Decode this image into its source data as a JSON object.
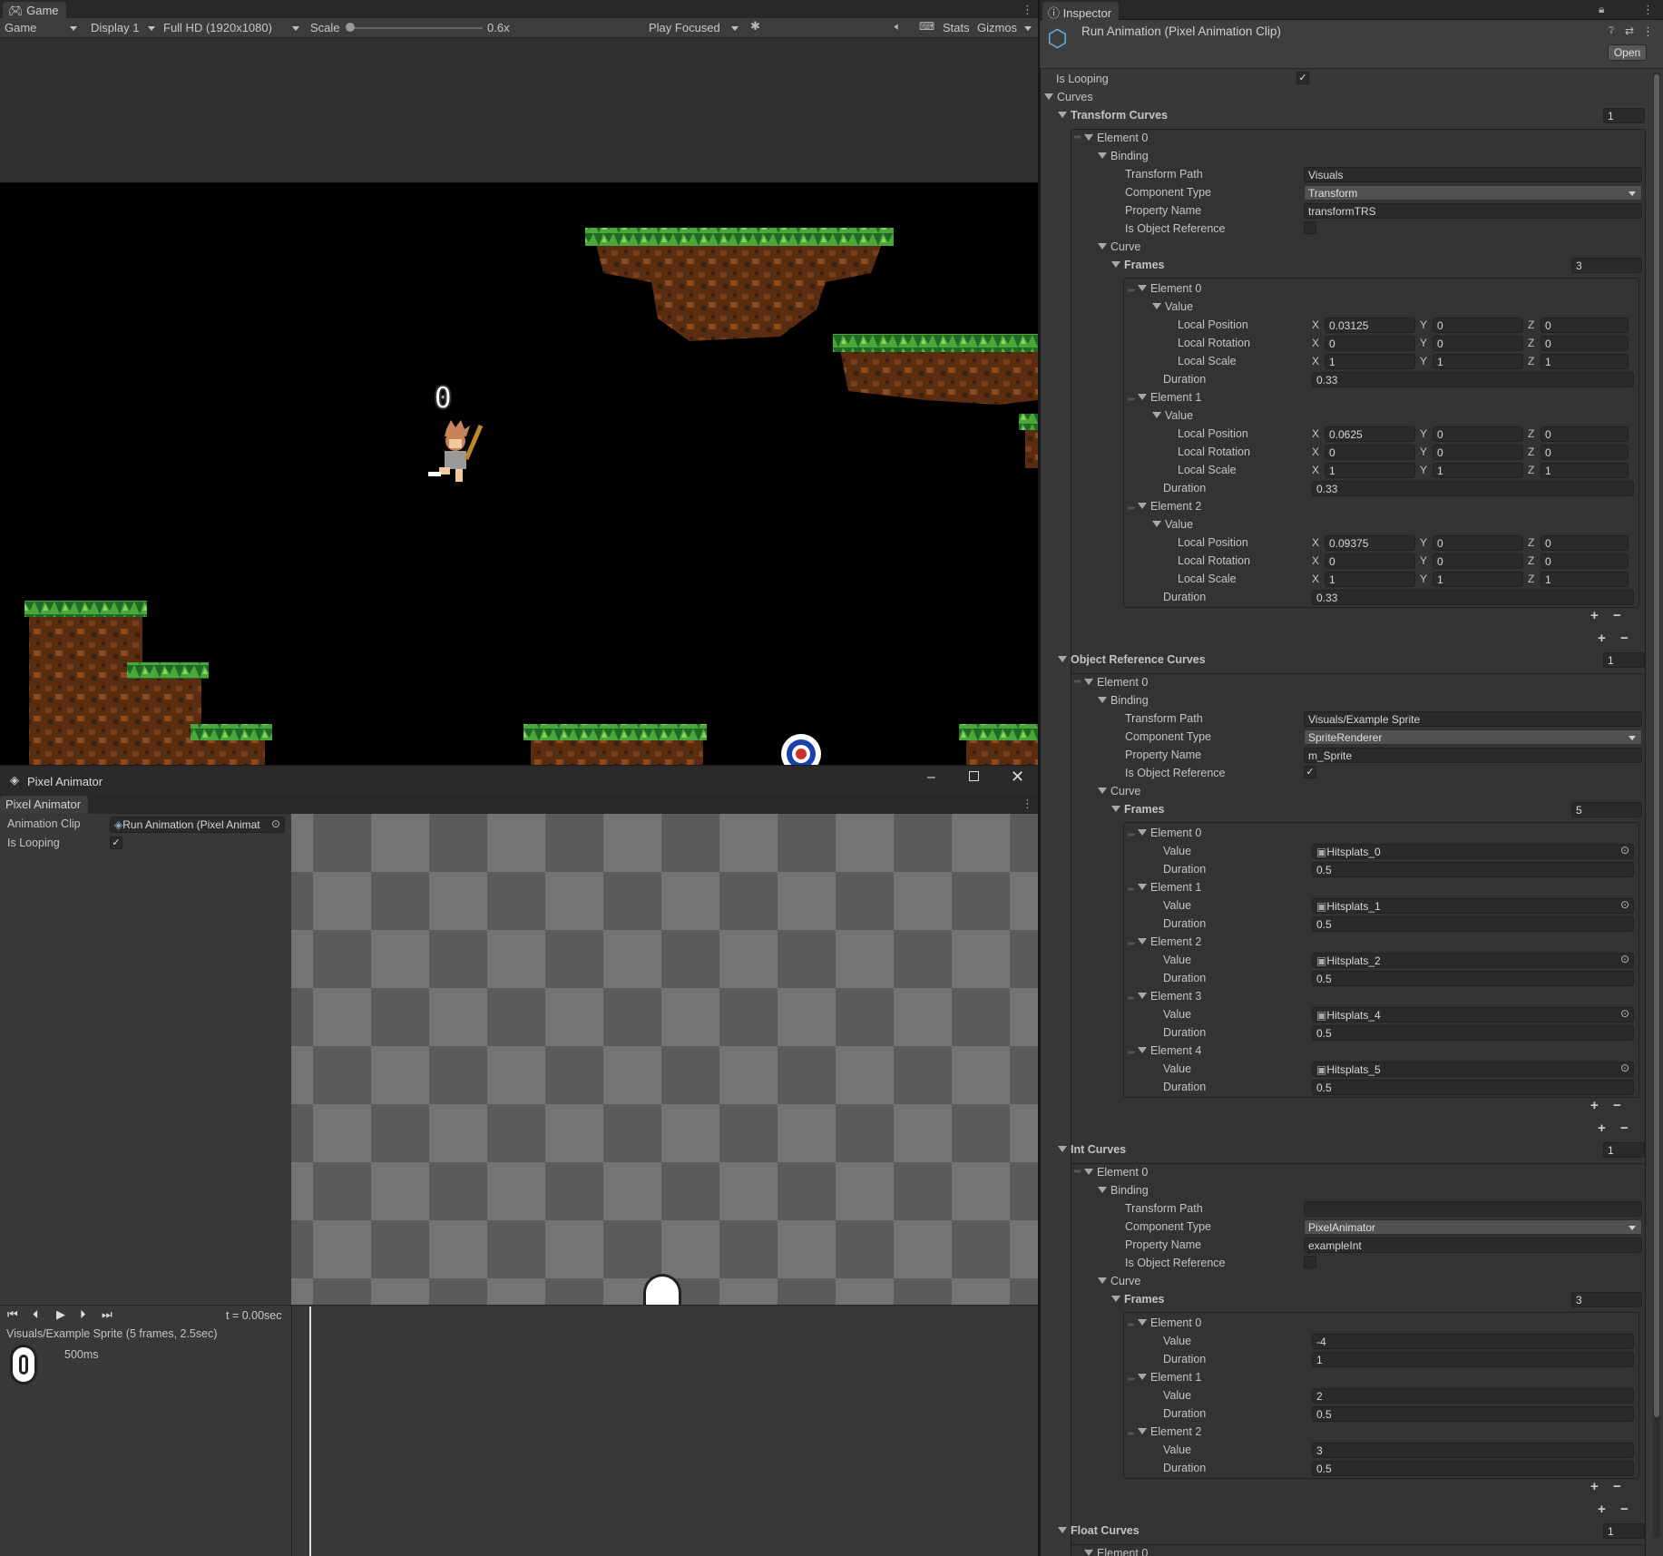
{
  "game": {
    "tab": "Game",
    "mode": "Game",
    "display": "Display 1",
    "resolution": "Full HD (1920x1080)",
    "scale_label": "Scale",
    "scale_value": "0.6x",
    "play_focused": "Play Focused",
    "stats": "Stats",
    "gizmos": "Gizmos",
    "score": "0"
  },
  "animator": {
    "title": "Pixel Animator",
    "tab": "Pixel Animator",
    "clip_label": "Animation Clip",
    "clip_value": "Run Animation (Pixel Animat",
    "loop_label": "Is Looping",
    "time": "t = 0.00sec",
    "track": "Visuals/Example Sprite (5 frames, 2.5sec)",
    "frame_ms": "500ms"
  },
  "inspector": {
    "tab": "Inspector",
    "asset_title": "Run Animation (Pixel Animation Clip)",
    "open": "Open",
    "is_looping": "Is Looping",
    "curves": "Curves",
    "tc": {
      "title": "Transform Curves",
      "count": "1",
      "el": "Element 0",
      "binding": "Binding",
      "tp": "Transform Path",
      "tp_v": "Visuals",
      "ct": "Component Type",
      "ct_v": "Transform",
      "pn": "Property Name",
      "pn_v": "transformTRS",
      "ior": "Is Object Reference",
      "curve": "Curve",
      "frames": "Frames",
      "frames_n": "3",
      "f": [
        {
          "el": "Element 0",
          "value": "Value",
          "lp": "Local Position",
          "lr": "Local Rotation",
          "ls": "Local Scale",
          "dur": "Duration",
          "px": "0.03125",
          "py": "0",
          "pz": "0",
          "rx": "0",
          "ry": "0",
          "rz": "0",
          "sx": "1",
          "sy": "1",
          "sz": "1",
          "d": "0.33"
        },
        {
          "el": "Element 1",
          "value": "Value",
          "lp": "Local Position",
          "lr": "Local Rotation",
          "ls": "Local Scale",
          "dur": "Duration",
          "px": "0.0625",
          "py": "0",
          "pz": "0",
          "rx": "0",
          "ry": "0",
          "rz": "0",
          "sx": "1",
          "sy": "1",
          "sz": "1",
          "d": "0.33"
        },
        {
          "el": "Element 2",
          "value": "Value",
          "lp": "Local Position",
          "lr": "Local Rotation",
          "ls": "Local Scale",
          "dur": "Duration",
          "px": "0.09375",
          "py": "0",
          "pz": "0",
          "rx": "0",
          "ry": "0",
          "rz": "0",
          "sx": "1",
          "sy": "1",
          "sz": "1",
          "d": "0.33"
        }
      ]
    },
    "orc": {
      "title": "Object Reference Curves",
      "count": "1",
      "el": "Element 0",
      "binding": "Binding",
      "tp": "Transform Path",
      "tp_v": "Visuals/Example Sprite",
      "ct": "Component Type",
      "ct_v": "SpriteRenderer",
      "pn": "Property Name",
      "pn_v": "m_Sprite",
      "ior": "Is Object Reference",
      "curve": "Curve",
      "frames": "Frames",
      "frames_n": "5",
      "f": [
        {
          "el": "Element 0",
          "value": "Value",
          "v": "Hitsplats_0",
          "dur": "Duration",
          "d": "0.5"
        },
        {
          "el": "Element 1",
          "value": "Value",
          "v": "Hitsplats_1",
          "dur": "Duration",
          "d": "0.5"
        },
        {
          "el": "Element 2",
          "value": "Value",
          "v": "Hitsplats_2",
          "dur": "Duration",
          "d": "0.5"
        },
        {
          "el": "Element 3",
          "value": "Value",
          "v": "Hitsplats_4",
          "dur": "Duration",
          "d": "0.5"
        },
        {
          "el": "Element 4",
          "value": "Value",
          "v": "Hitsplats_5",
          "dur": "Duration",
          "d": "0.5"
        }
      ]
    },
    "ic": {
      "title": "Int Curves",
      "count": "1",
      "el": "Element 0",
      "binding": "Binding",
      "tp": "Transform Path",
      "tp_v": "",
      "ct": "Component Type",
      "ct_v": "PixelAnimator",
      "pn": "Property Name",
      "pn_v": "exampleInt",
      "ior": "Is Object Reference",
      "curve": "Curve",
      "frames": "Frames",
      "frames_n": "3",
      "f": [
        {
          "el": "Element 0",
          "value": "Value",
          "v": "-4",
          "dur": "Duration",
          "d": "1"
        },
        {
          "el": "Element 1",
          "value": "Value",
          "v": "2",
          "dur": "Duration",
          "d": "0.5"
        },
        {
          "el": "Element 2",
          "value": "Value",
          "v": "3",
          "dur": "Duration",
          "d": "0.5"
        }
      ]
    },
    "fc": {
      "title": "Float Curves",
      "count": "1",
      "el": "Element 0"
    }
  }
}
